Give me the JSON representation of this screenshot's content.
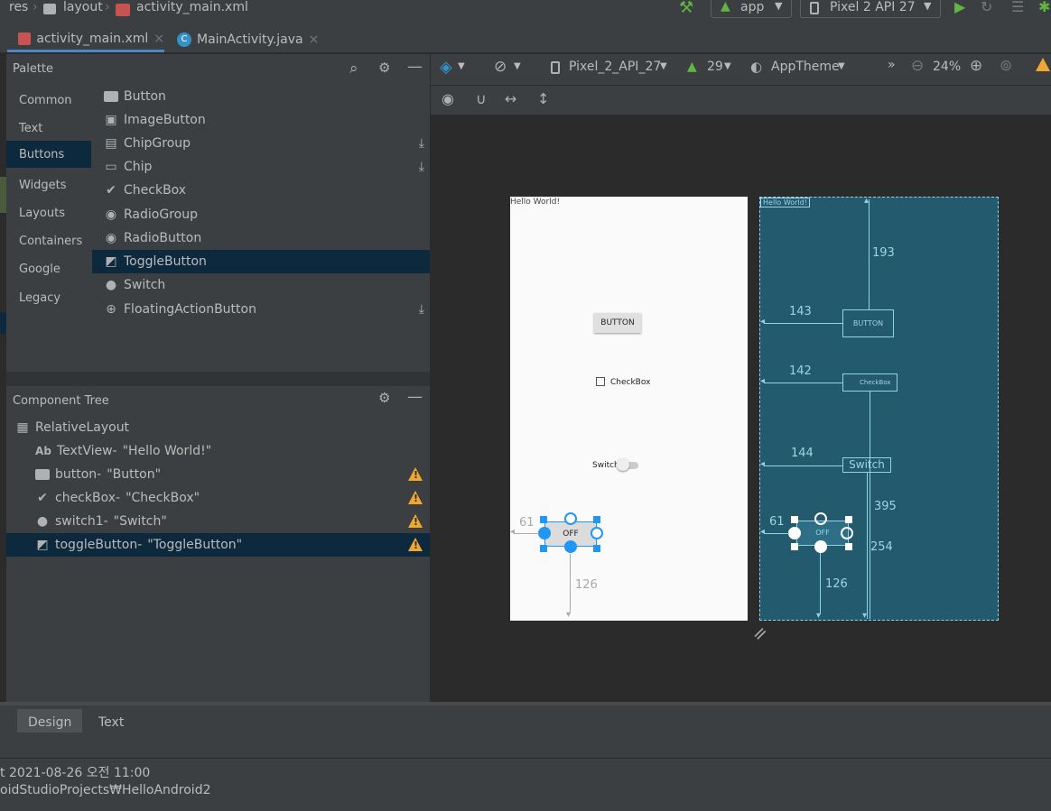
{
  "topbar": {
    "crumb_res": "res",
    "crumb_layout": "layout",
    "crumb_file": "activity_main.xml",
    "run_config": "app",
    "device": "Pixel 2 API 27"
  },
  "tabs": [
    {
      "label": "activity_main.xml"
    },
    {
      "label": "MainActivity.java"
    }
  ],
  "palette": {
    "title": "Palette",
    "categories": [
      "Common",
      "Text",
      "Buttons",
      "Widgets",
      "Layouts",
      "Containers",
      "Google",
      "Legacy"
    ],
    "selected_category": "Buttons",
    "items": [
      {
        "label": "Button",
        "icon": "button-icon"
      },
      {
        "label": "ImageButton",
        "icon": "image-icon"
      },
      {
        "label": "ChipGroup",
        "icon": "chipgroup-icon"
      },
      {
        "label": "Chip",
        "icon": "chip-icon"
      },
      {
        "label": "CheckBox",
        "icon": "check-icon"
      },
      {
        "label": "RadioGroup",
        "icon": "radio-icon"
      },
      {
        "label": "RadioButton",
        "icon": "radio-icon"
      },
      {
        "label": "ToggleButton",
        "icon": "toggle-icon"
      },
      {
        "label": "Switch",
        "icon": "switch-icon"
      },
      {
        "label": "FloatingActionButton",
        "icon": "plus-circle-icon"
      }
    ],
    "selected_item": "ToggleButton"
  },
  "component_tree": {
    "title": "Component Tree",
    "items": [
      {
        "name": "RelativeLayout",
        "text": ""
      },
      {
        "name": "TextView-",
        "text": "\"Hello World!\"",
        "prefix": "Ab"
      },
      {
        "name": "button-",
        "text": "\"Button\""
      },
      {
        "name": "checkBox-",
        "text": "\"CheckBox\""
      },
      {
        "name": "switch1-",
        "text": "\"Switch\""
      },
      {
        "name": "toggleButton-",
        "text": "\"ToggleButton\""
      }
    ]
  },
  "design_toolbar": {
    "device": "Pixel_2_API_27",
    "api": "29",
    "theme": "AppTheme",
    "zoom": "24%"
  },
  "design": {
    "hello": "Hello World!",
    "button": "BUTTON",
    "checkbox": "CheckBox",
    "switch": "Switch",
    "toggle": "OFF",
    "dim_193": "193",
    "dim_143": "143",
    "dim_142": "142",
    "dim_144": "144",
    "dim_395": "395",
    "dim_254": "254",
    "dim_61": "61",
    "dim_126": "126"
  },
  "bottom_tabs": [
    "Design",
    "Text"
  ],
  "status": {
    "line1": "t 2021-08-26 오전 11:00",
    "line2": "oidStudioProjects₩HelloAndroid2"
  },
  "colors": {
    "selection": "#0d293e",
    "blueprint": "#245a6e",
    "warning": "#f0a732",
    "handle": "#2196f3"
  }
}
